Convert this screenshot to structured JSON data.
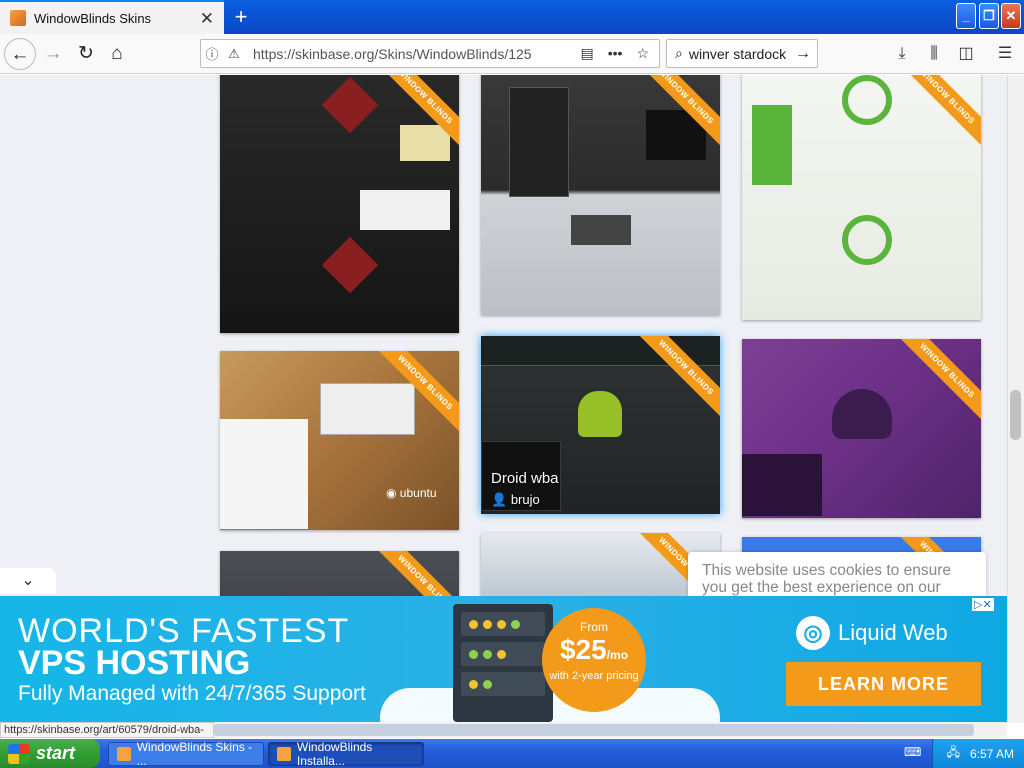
{
  "browser": {
    "tab_title": "WindowBlinds Skins",
    "url": "https://skinbase.org/Skins/WindowBlinds/125",
    "search_value": "winver stardock"
  },
  "cards": [
    {
      "ribbon": "WINDOW BLINDS",
      "hover_title": "",
      "hover_author": ""
    },
    {
      "ribbon": "WINDOW BLINDS",
      "hover_title": "",
      "hover_author": ""
    },
    {
      "ribbon": "WINDOW BLINDS",
      "hover_title": "",
      "hover_author": ""
    },
    {
      "ribbon": "WINDOW BLINDS",
      "hover_title": "",
      "hover_author": ""
    },
    {
      "ribbon": "WINDOW BLINDS",
      "hover_title": "Droid wba",
      "hover_author": "brujo"
    },
    {
      "ribbon": "WINDOW BLINDS",
      "hover_title": "",
      "hover_author": ""
    },
    {
      "ribbon": "WINDOW BLINDS",
      "hover_title": "",
      "hover_author": ""
    },
    {
      "ribbon": "WINDOW BLINDS",
      "hover_title": "",
      "hover_author": ""
    },
    {
      "ribbon": "WINDOW BLINDS",
      "hover_title": "",
      "hover_author": ""
    }
  ],
  "cookie_text": "This website uses cookies to ensure you get the best experience on our",
  "ad": {
    "line1": "WORLD'S FASTEST",
    "line2": "VPS HOSTING",
    "line3": "Fully Managed with 24/7/365 Support",
    "price_from": "From",
    "price": "$25",
    "price_unit": "/mo",
    "price_sub": "with 2-year pricing",
    "brand": "Liquid Web",
    "cta": "LEARN MORE",
    "adchoices": "▷✕"
  },
  "status_url": "https://skinbase.org/art/60579/droid-wba-",
  "taskbar": {
    "start": "start",
    "task1": "WindowBlinds Skins - ...",
    "task2": "WindowBlinds Installa...",
    "clock": "6:57 AM"
  },
  "colors": {
    "accent": "#0a84ff",
    "ribbon": "#f39a1a",
    "ad_bg": "#15b6e8",
    "xp_blue": "#245edb",
    "start_green": "#2f9a2f"
  }
}
